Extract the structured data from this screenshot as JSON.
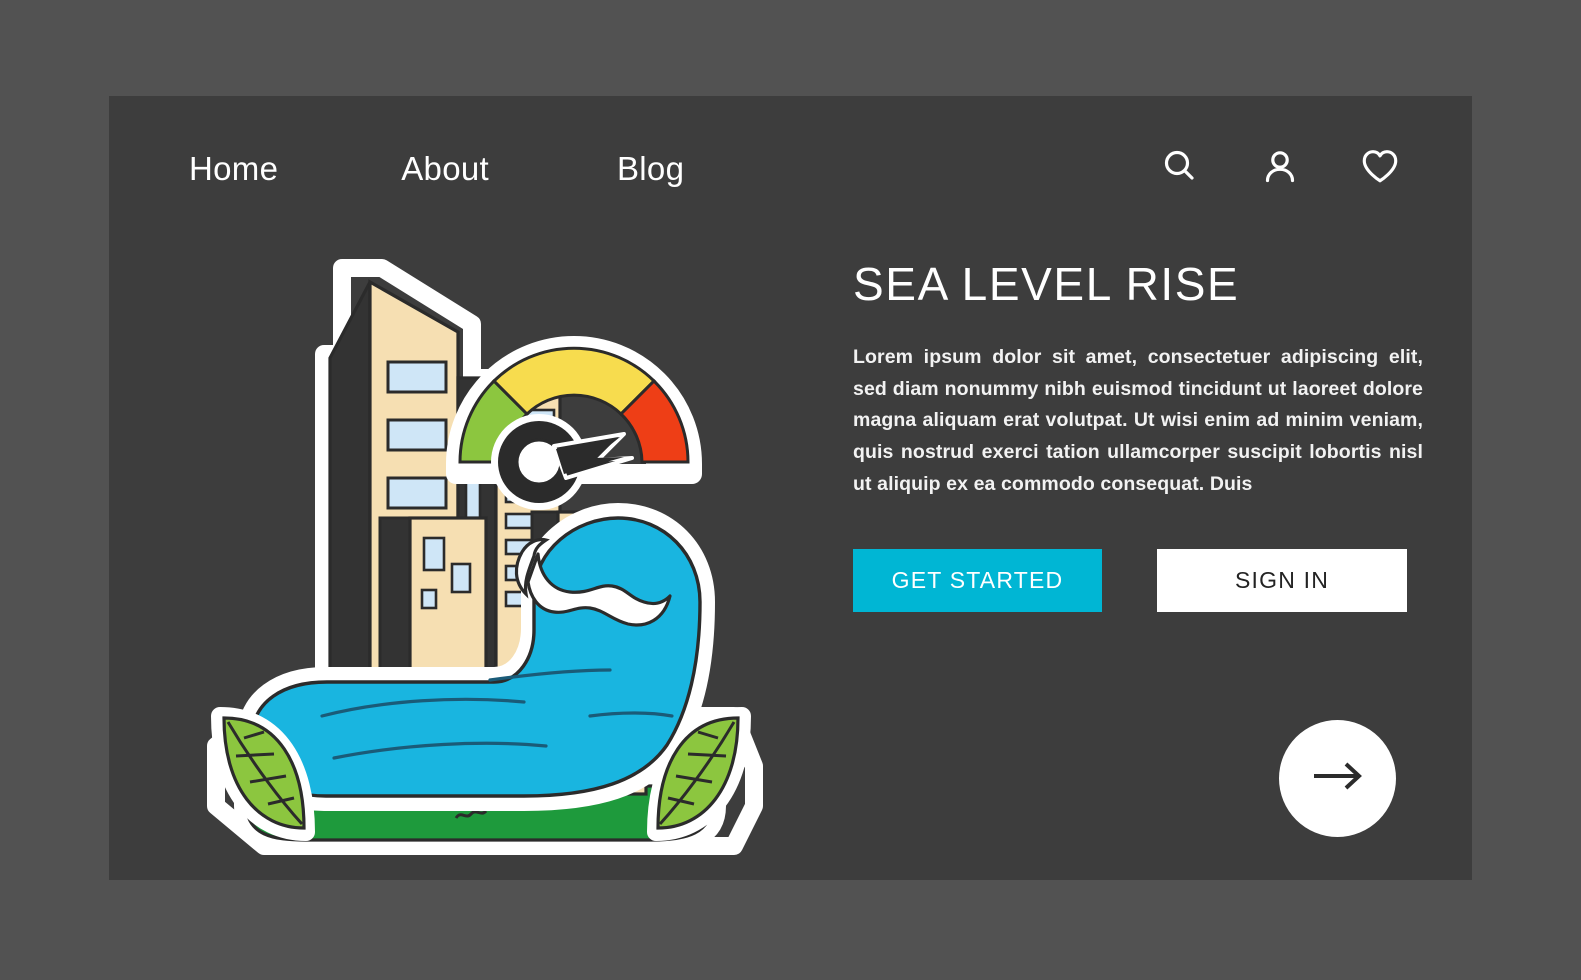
{
  "theme": {
    "page_background": "#525252",
    "panel_background": "#3d3d3d",
    "accent_cyan": "#00b6d4",
    "text_light": "#ffffff",
    "wave_blue": "#19b5e0",
    "leaf_green": "#8cc63f",
    "grass_green": "#1e9a3c",
    "building_tan": "#f6dfb2",
    "window_blue": "#cfe6f7",
    "gauge_green": "#8cc63f",
    "gauge_yellow": "#f7dc4e",
    "gauge_red": "#ee3e16",
    "outline_dark": "#2b2b2b"
  },
  "nav": {
    "links": [
      {
        "label": "Home"
      },
      {
        "label": "About"
      },
      {
        "label": "Blog"
      }
    ],
    "icons": [
      {
        "name": "search-icon",
        "label": "Search"
      },
      {
        "name": "user-icon",
        "label": "Account"
      },
      {
        "name": "heart-icon",
        "label": "Favorites"
      }
    ]
  },
  "hero": {
    "headline": "SEA LEVEL RISE",
    "paragraph": "Lorem ipsum dolor sit amet, consectetuer adipiscing elit, sed diam nonummy nibh euismod tincidunt ut laoreet dolore magna aliquam erat volutpat. Ut wisi enim ad minim veniam, quis nostrud exerci tation ullamcorper suscipit lobortis nisl ut aliquip ex ea commodo consequat. Duis",
    "primary_cta": "GET STARTED",
    "secondary_cta": "SIGN IN",
    "next_button_icon": "arrow-right-icon"
  },
  "illustration": {
    "name": "sea-level-rise-illustration",
    "elements": [
      "city-buildings",
      "risk-gauge-meter",
      "ocean-wave",
      "leaf-left",
      "leaf-right",
      "grass-ground"
    ],
    "gauge": {
      "zones": [
        "green",
        "yellow",
        "red"
      ],
      "needle_zone": "red"
    }
  }
}
